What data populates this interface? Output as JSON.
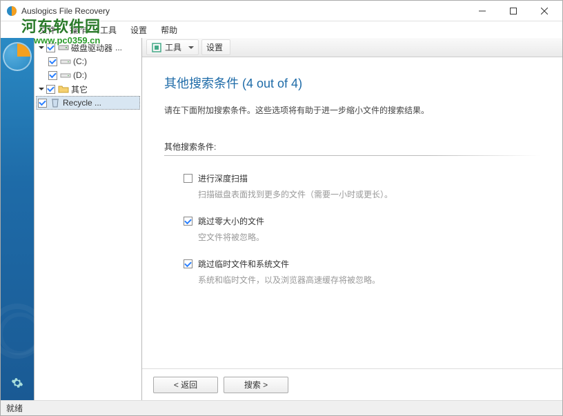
{
  "window": {
    "title": "Auslogics File Recovery"
  },
  "watermark": {
    "main": "河东软件园",
    "sub": "www.pc0359.cn"
  },
  "menu": {
    "items": [
      "文件",
      "操作",
      "工具",
      "设置",
      "帮助"
    ]
  },
  "tree": {
    "root1": {
      "label": "磁盘驱动器",
      "ellipsis": "..."
    },
    "driveC": {
      "label": "(C:)"
    },
    "driveD": {
      "label": "(D:)"
    },
    "root2": {
      "label": "其它"
    },
    "recycle": {
      "label": "Recycle ..."
    }
  },
  "toolbar": {
    "tools": "工具",
    "settings": "设置"
  },
  "page": {
    "title": "其他搜索条件",
    "counter": "(4 out of 4)",
    "desc": "请在下面附加搜索条件。这些选项将有助于进一步缩小文件的搜索结果。",
    "section_label": "其他搜索条件:"
  },
  "options": [
    {
      "checked": false,
      "label": "进行深度扫描",
      "desc": "扫描磁盘表面找到更多的文件（需要一小时或更长）。"
    },
    {
      "checked": true,
      "label": "跳过零大小的文件",
      "desc": "空文件将被忽略。"
    },
    {
      "checked": true,
      "label": "跳过临时文件和系统文件",
      "desc": "系统和临时文件，以及浏览器高速缓存将被忽略。"
    }
  ],
  "buttons": {
    "back": "<  返回",
    "search": "搜索  >"
  },
  "status": {
    "text": "就绪"
  }
}
